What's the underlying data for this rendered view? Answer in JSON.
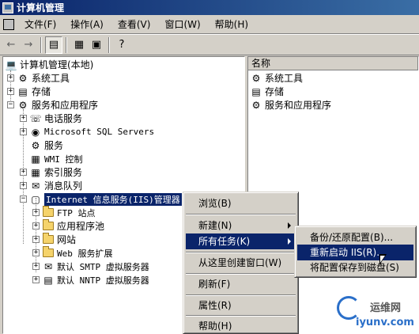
{
  "window": {
    "title": "计算机管理"
  },
  "menubar": {
    "items": [
      "文件(F)",
      "操作(A)",
      "查看(V)",
      "窗口(W)",
      "帮助(H)"
    ]
  },
  "toolbar": {
    "icons": [
      "back-arrow-icon",
      "forward-arrow-icon",
      "show-tree-icon",
      "properties-icon",
      "export-list-icon",
      "help-icon"
    ]
  },
  "tree": {
    "root": "计算机管理(本地)",
    "system_tools": "系统工具",
    "storage": "存储",
    "services_apps": "服务和应用程序",
    "telephony": "电话服务",
    "sql_servers": "Microsoft SQL Servers",
    "services": "服务",
    "wmi": "WMI 控制",
    "indexing": "索引服务",
    "msmq": "消息队列",
    "iis": "Internet 信息服务(IIS)管理器",
    "ftp": "FTP 站点",
    "app_pools": "应用程序池",
    "websites": "网站",
    "web_ext": "Web 服务扩展",
    "smtp": "默认 SMTP 虚拟服务器",
    "nntp": "默认 NNTP 虚拟服务器"
  },
  "rightpane": {
    "column": "名称",
    "items": [
      "系统工具",
      "存储",
      "服务和应用程序"
    ]
  },
  "context_menu": {
    "browse": "浏览(B)",
    "new": "新建(N)",
    "all_tasks": "所有任务(K)",
    "new_window": "从这里创建窗口(W)",
    "refresh": "刷新(F)",
    "properties": "属性(R)",
    "help": "帮助(H)"
  },
  "submenu": {
    "backup": "备份/还原配置(B)...",
    "restart": "重新启动 IIS(R)...",
    "save_disk": "将配置保存到磁盘(S)"
  },
  "watermark": {
    "name": "运维网",
    "url": "iyunv.com"
  }
}
